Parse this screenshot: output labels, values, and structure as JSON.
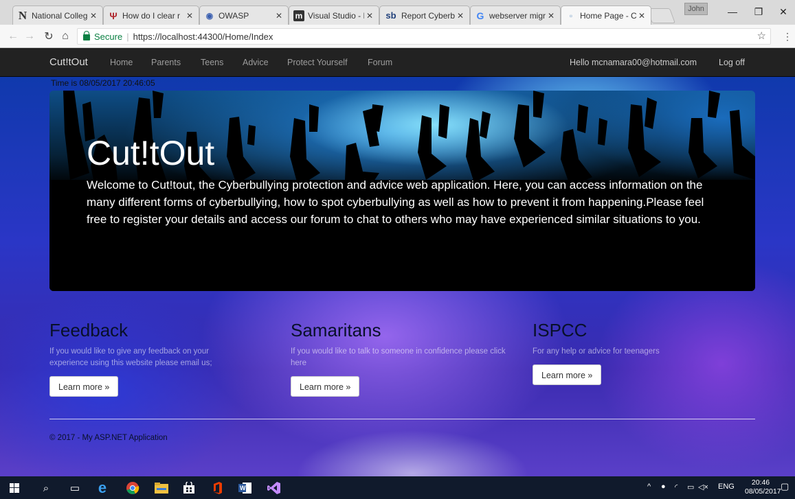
{
  "browser": {
    "tabs": [
      {
        "label": "National College",
        "icon": "N",
        "active": false
      },
      {
        "label": "How do I clear r",
        "icon": "Ψ",
        "active": false
      },
      {
        "label": "OWASP",
        "icon": "◉",
        "active": false
      },
      {
        "label": "Visual Studio - H",
        "icon": "m",
        "active": false
      },
      {
        "label": "Report Cyberbu",
        "icon": "sb",
        "active": false
      },
      {
        "label": "webserver migr",
        "icon": "G",
        "active": false
      },
      {
        "label": "Home Page - Cu",
        "icon": "▫",
        "active": true
      }
    ],
    "profile_name": "John",
    "secure_label": "Secure",
    "url": "https://localhost:44300/Home/Index"
  },
  "navbar": {
    "brand": "Cut!tOut",
    "links": [
      "Home",
      "Parents",
      "Teens",
      "Advice",
      "Protect Yourself",
      "Forum"
    ],
    "greeting": "Hello mcnamara00@hotmail.com",
    "logoff": "Log off"
  },
  "timestamp": "Time is 08/05/2017 20:46:05",
  "jumbotron": {
    "title": "Cut!tOut",
    "text": "Welcome to Cut!tout, the Cyberbullying protection and advice web application. Here, you can access information on the many different forms of cyberbullying, how to spot cyberbullying as well as how to prevent it from happening.Please feel free to register your details and access our forum to chat to others who may have experienced similar situations to you."
  },
  "columns": [
    {
      "heading": "Feedback",
      "text": "If you would like to give any feedback on your experience using this website please email us;",
      "button": "Learn more »"
    },
    {
      "heading": "Samaritans",
      "text": "If you would like to talk to someone in confidence please click here",
      "button": "Learn more »"
    },
    {
      "heading": "ISPCC",
      "text": "For any help or advice for teenagers",
      "button": "Learn more »"
    }
  ],
  "footer": "© 2017 - My ASP.NET Application",
  "taskbar": {
    "language": "ENG",
    "time": "20:46",
    "date": "08/05/2017"
  },
  "colors": {
    "navbar_bg": "#222222",
    "secure_green": "#0b8043",
    "taskbar_bg": "#101a2c"
  }
}
